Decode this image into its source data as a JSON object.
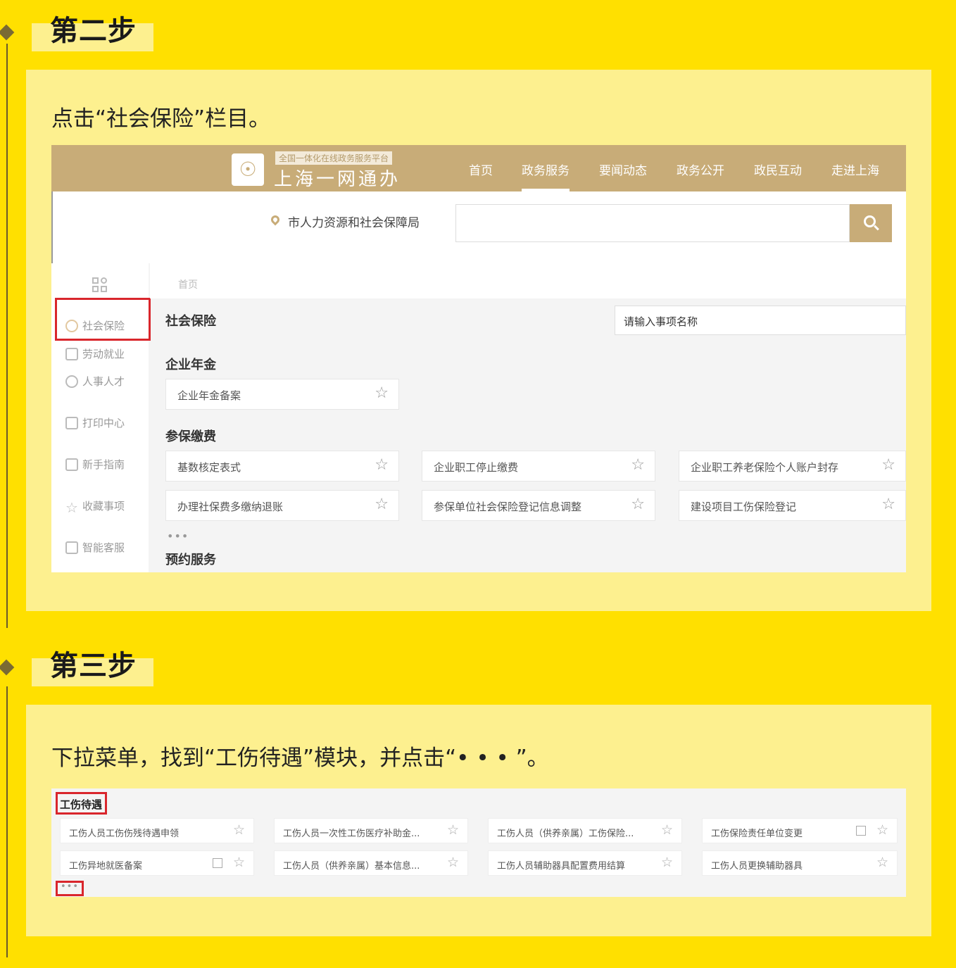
{
  "step2": {
    "title": "第二步",
    "instruction": "点击“社会保险”栏目。"
  },
  "step3": {
    "title": "第三步",
    "instruction": "下拉菜单，找到“工伤待遇”模块，并点击“• • • ”。"
  },
  "portal": {
    "platform_tag": "全国一体化在线政务服务平台",
    "brand": "上海一网通办",
    "nav": [
      "首页",
      "政务服务",
      "要闻动态",
      "政务公开",
      "政民互动",
      "走进上海"
    ],
    "active_nav": "政务服务",
    "department": "市人力资源和社会保障局",
    "sidebar": [
      "社会保险",
      "劳动就业",
      "人事人才",
      "打印中心",
      "新手指南",
      "收藏事项",
      "智能客服"
    ],
    "breadcrumb": "首页",
    "section_title": "社会保险",
    "search_placeholder": "请输入事项名称",
    "groups": [
      {
        "title": "企业年金",
        "items": [
          "企业年金备案"
        ]
      },
      {
        "title": "参保缴费",
        "items": [
          "基数核定表式",
          "企业职工停止缴费",
          "企业职工养老保险个人账户封存",
          "办理社保费多缴纳退账",
          "参保单位社会保险登记信息调整",
          "建设项目工伤保险登记"
        ]
      },
      {
        "title": "预约服务",
        "items": []
      }
    ],
    "more": "•••"
  },
  "injury": {
    "title": "工伤待遇",
    "items": [
      "工伤人员工伤伤残待遇申领",
      "工伤人员一次性工伤医疗补助金...",
      "工伤人员（供养亲属）工伤保险...",
      "工伤保险责任单位变更",
      "工伤异地就医备案",
      "工伤人员（供养亲属）基本信息...",
      "工伤人员辅助器具配置费用结算",
      "工伤人员更换辅助器具"
    ],
    "more": "•••"
  },
  "colors": {
    "background": "#FFE000",
    "panel": "#FDF08F",
    "portal_gold": "#C8AC78",
    "highlight_red": "#D9262C"
  }
}
